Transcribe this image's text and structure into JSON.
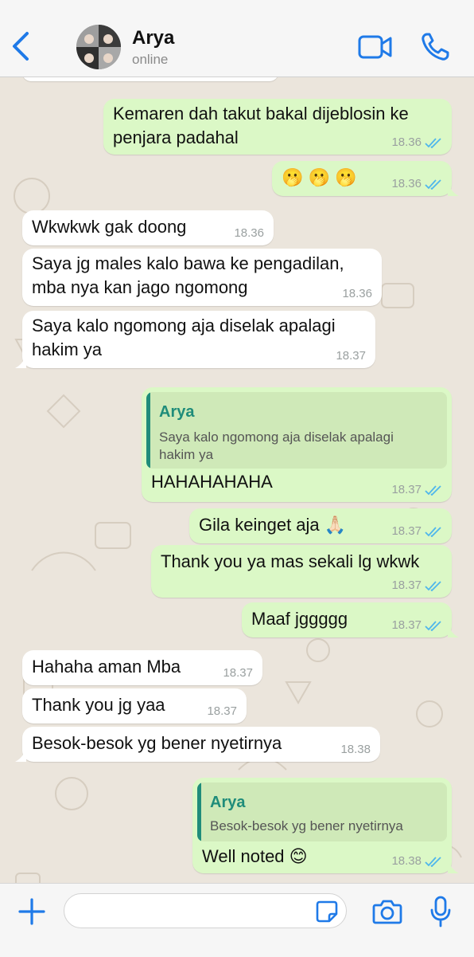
{
  "header": {
    "contact_name": "Arya",
    "status": "online",
    "accent": "#1f7ae8"
  },
  "messages": [
    {
      "dir": "out",
      "text_lines": [
        "Kemaren dah takut bakal dijeblosin ke",
        "penjara padahal"
      ],
      "time": "18.36",
      "read": true
    },
    {
      "dir": "out",
      "text_lines": [
        "🫢 🫢 🫢"
      ],
      "time": "18.36",
      "read": true
    },
    {
      "dir": "in",
      "text_lines": [
        "Wkwkwk gak doong"
      ],
      "time": "18.36"
    },
    {
      "dir": "in",
      "text_lines": [
        "Saya jg males kalo bawa ke pengadilan,",
        "mba nya kan jago ngomong"
      ],
      "time": "18.36"
    },
    {
      "dir": "in",
      "text_lines": [
        "Saya kalo ngomong aja diselak apalagi",
        "hakim ya"
      ],
      "time": "18.37"
    },
    {
      "dir": "out",
      "quote": {
        "author": "Arya",
        "text_lines": [
          "Saya kalo ngomong aja diselak apalagi",
          "hakim ya"
        ]
      },
      "text_lines": [
        "HAHAHAHAHA"
      ],
      "time": "18.37",
      "read": true
    },
    {
      "dir": "out",
      "text_lines": [
        "Gila keinget aja 🙏🏻"
      ],
      "time": "18.37",
      "read": true
    },
    {
      "dir": "out",
      "text_lines": [
        "Thank you ya mas sekali lg wkwk"
      ],
      "time": "18.37",
      "read": true
    },
    {
      "dir": "out",
      "text_lines": [
        "Maaf jggggg"
      ],
      "time": "18.37",
      "read": true
    },
    {
      "dir": "in",
      "text_lines": [
        "Hahaha aman Mba"
      ],
      "time": "18.37"
    },
    {
      "dir": "in",
      "text_lines": [
        "Thank you jg yaa"
      ],
      "time": "18.37"
    },
    {
      "dir": "in",
      "text_lines": [
        "Besok-besok yg bener nyetirnya"
      ],
      "time": "18.38"
    },
    {
      "dir": "out",
      "quote": {
        "author": "Arya",
        "text_lines": [
          "Besok-besok yg bener nyetirnya"
        ]
      },
      "text_lines": [
        "Well noted 😊"
      ],
      "time": "18.38",
      "read": true
    }
  ],
  "footer": {
    "input_value": "",
    "icons": [
      "plus-icon",
      "sticker-icon",
      "camera-icon",
      "microphone-icon"
    ]
  },
  "colors": {
    "outgoing_bubble": "#dbf8c6",
    "incoming_bubble": "#ffffff",
    "read_tick": "#4fb6ec",
    "quote_author": "#1f8c7a"
  }
}
